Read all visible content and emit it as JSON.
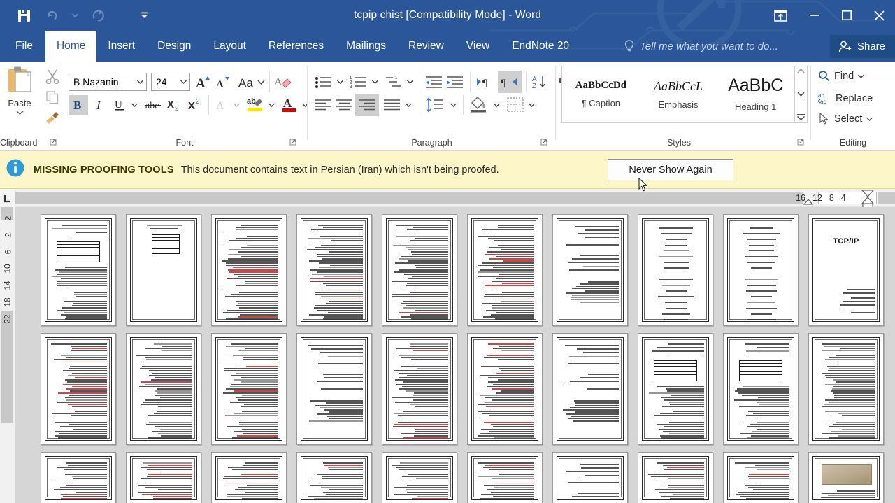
{
  "titlebar": {
    "document_title": "tcpip chist [Compatibility Mode] - Word",
    "quick_access": [
      {
        "name": "save-button",
        "icon": "save-icon",
        "enabled": true
      },
      {
        "name": "undo-button",
        "icon": "undo-icon",
        "enabled": false
      },
      {
        "name": "redo-button",
        "icon": "redo-icon",
        "enabled": false
      },
      {
        "name": "customize-quick-access-button",
        "icon": "chevron-down-icon",
        "enabled": true
      }
    ],
    "window_controls": [
      {
        "name": "ribbon-display-options-button",
        "icon": "ribbon-display-icon"
      },
      {
        "name": "minimize-button",
        "icon": "minimize-icon"
      },
      {
        "name": "restore-button",
        "icon": "restore-icon"
      },
      {
        "name": "close-button",
        "icon": "close-icon"
      }
    ],
    "accent_color": "#2b579a"
  },
  "ribbon_tabs": {
    "items": [
      {
        "label": "File",
        "active": false
      },
      {
        "label": "Home",
        "active": true
      },
      {
        "label": "Insert",
        "active": false
      },
      {
        "label": "Design",
        "active": false
      },
      {
        "label": "Layout",
        "active": false
      },
      {
        "label": "References",
        "active": false
      },
      {
        "label": "Mailings",
        "active": false
      },
      {
        "label": "Review",
        "active": false
      },
      {
        "label": "View",
        "active": false
      },
      {
        "label": "EndNote 20",
        "active": false
      }
    ],
    "tell_me": "Tell me what you want to do...",
    "share_label": "Share"
  },
  "ribbon": {
    "groups": [
      {
        "label": "Clipboard"
      },
      {
        "label": "Font"
      },
      {
        "label": "Paragraph"
      },
      {
        "label": "Styles"
      },
      {
        "label": "Editing"
      }
    ],
    "clipboard": {
      "paste_label": "Paste",
      "cut_name": "cut-icon",
      "copy_name": "copy-icon",
      "format_painter_name": "format-painter-icon"
    },
    "font": {
      "font_name": "B Nazanin",
      "font_size": "24",
      "bold_active": true,
      "italic_active": false,
      "underline_active": false
    },
    "paragraph": {
      "align_right_active": true,
      "rtl_direction_active": true
    },
    "styles": {
      "gallery": [
        {
          "sample": "AaBbCcDd",
          "name": "¶ Caption"
        },
        {
          "sample": "AaBbCcL",
          "name": "Emphasis"
        },
        {
          "sample": "AaBbC",
          "name": "Heading 1"
        }
      ]
    },
    "editing": {
      "find_label": "Find",
      "replace_label": "Replace",
      "select_label": "Select"
    }
  },
  "message_bar": {
    "icon": "info-icon",
    "strong_text": "MISSING PROOFING TOOLS",
    "text": "This document contains text in Persian (Iran) which isn't being proofed.",
    "button_label": "Never Show Again",
    "background_color": "#fdf6c8"
  },
  "rulers": {
    "horizontal_numbers": [
      "16",
      "12",
      "8",
      "4"
    ],
    "vertical_numbers": [
      "2",
      "2",
      "6",
      "10",
      "14",
      "18",
      "22"
    ]
  },
  "document": {
    "view": "multiple-pages",
    "rows": [
      {
        "pages": [
          {
            "kind": "text-table",
            "title": ""
          },
          {
            "kind": "table-only",
            "title": ""
          },
          {
            "kind": "text-dense",
            "title": ""
          },
          {
            "kind": "text-dense",
            "title": ""
          },
          {
            "kind": "text-dense",
            "title": ""
          },
          {
            "kind": "text-dense",
            "title": ""
          },
          {
            "kind": "text-sparse",
            "title": ""
          },
          {
            "kind": "toc",
            "title": ""
          },
          {
            "kind": "toc",
            "title": ""
          },
          {
            "kind": "cover",
            "title": "TCP/IP"
          }
        ]
      },
      {
        "pages": [
          {
            "kind": "text-dense",
            "title": ""
          },
          {
            "kind": "text-dense",
            "title": ""
          },
          {
            "kind": "text-dense",
            "title": ""
          },
          {
            "kind": "text-sparse",
            "title": ""
          },
          {
            "kind": "text-dense",
            "title": ""
          },
          {
            "kind": "text-dense",
            "title": ""
          },
          {
            "kind": "text-sparse",
            "title": ""
          },
          {
            "kind": "text-table",
            "title": ""
          },
          {
            "kind": "text-table",
            "title": ""
          },
          {
            "kind": "text-dense",
            "title": ""
          }
        ]
      },
      {
        "pages": [
          {
            "kind": "text-dense",
            "title": ""
          },
          {
            "kind": "text-dense",
            "title": ""
          },
          {
            "kind": "text-dense",
            "title": ""
          },
          {
            "kind": "text-dense",
            "title": ""
          },
          {
            "kind": "text-dense",
            "title": ""
          },
          {
            "kind": "text-dense",
            "title": ""
          },
          {
            "kind": "text-sparse",
            "title": ""
          },
          {
            "kind": "text-dense",
            "title": ""
          },
          {
            "kind": "text-dense",
            "title": ""
          },
          {
            "kind": "photo",
            "title": ""
          }
        ]
      }
    ]
  }
}
